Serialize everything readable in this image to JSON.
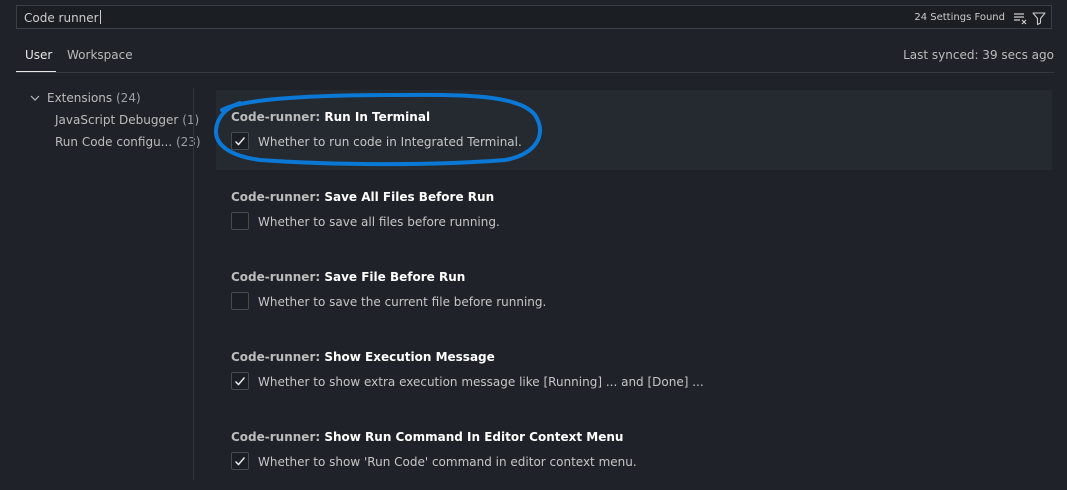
{
  "search": {
    "value": "Code runner",
    "result_count": "24 Settings Found"
  },
  "tabs": [
    {
      "label": "User",
      "active": true
    },
    {
      "label": "Workspace",
      "active": false
    }
  ],
  "sync_status": "Last synced: 39 secs ago",
  "toc": {
    "root": {
      "label": "Extensions",
      "count": "(24)"
    },
    "children": [
      {
        "label": "JavaScript Debugger",
        "count": "(1)"
      },
      {
        "label": "Run Code configu...",
        "count": "(23)"
      }
    ]
  },
  "settings": [
    {
      "category": "Code-runner: ",
      "name": "Run In Terminal",
      "description": "Whether to run code in Integrated Terminal.",
      "checked": true
    },
    {
      "category": "Code-runner: ",
      "name": "Save All Files Before Run",
      "description": "Whether to save all files before running.",
      "checked": false
    },
    {
      "category": "Code-runner: ",
      "name": "Save File Before Run",
      "description": "Whether to save the current file before running.",
      "checked": false
    },
    {
      "category": "Code-runner: ",
      "name": "Show Execution Message",
      "description": "Whether to show extra execution message like [Running] ... and [Done] ...",
      "checked": true
    },
    {
      "category": "Code-runner: ",
      "name": "Show Run Command In Editor Context Menu",
      "description": "Whether to show 'Run Code' command in editor context menu.",
      "checked": true
    }
  ],
  "icons": {
    "clear": "clear-filter-icon",
    "filter": "filter-icon",
    "chevron": "chevron-down-icon",
    "check": "check-icon"
  },
  "colors": {
    "background": "#1f2329",
    "highlight_row": "#252a31",
    "annotation": "#0a78d4"
  }
}
